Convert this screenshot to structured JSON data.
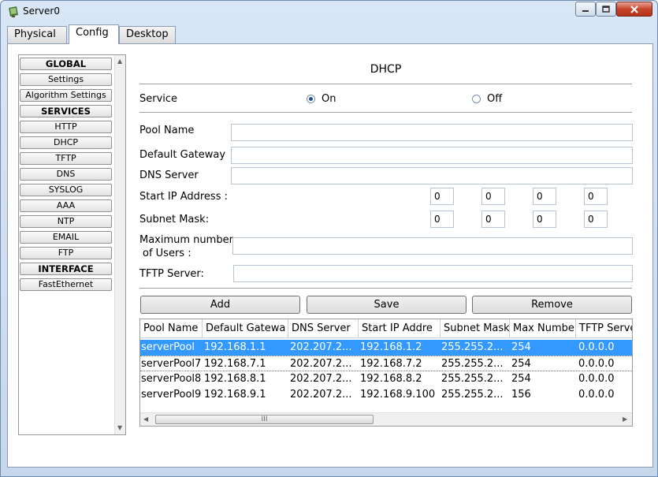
{
  "window": {
    "title": "Server0",
    "tabs": [
      "Physical",
      "Config",
      "Desktop"
    ],
    "active_tab": "Config"
  },
  "sidebar": {
    "items": [
      {
        "label": "GLOBAL",
        "header": true
      },
      {
        "label": "Settings"
      },
      {
        "label": "Algorithm Settings"
      },
      {
        "label": "SERVICES",
        "header": true
      },
      {
        "label": "HTTP"
      },
      {
        "label": "DHCP"
      },
      {
        "label": "TFTP"
      },
      {
        "label": "DNS"
      },
      {
        "label": "SYSLOG"
      },
      {
        "label": "AAA"
      },
      {
        "label": "NTP"
      },
      {
        "label": "EMAIL"
      },
      {
        "label": "FTP"
      },
      {
        "label": "INTERFACE",
        "header": true
      },
      {
        "label": "FastEthernet"
      }
    ]
  },
  "dhcp": {
    "heading": "DHCP",
    "service_label": "Service",
    "on_label": "On",
    "off_label": "Off",
    "service_state": "On",
    "pool_name_label": "Pool Name",
    "pool_name_value": "",
    "default_gateway_label": "Default Gateway",
    "default_gateway_value": "",
    "dns_server_label": "DNS Server",
    "dns_server_value": "",
    "start_ip_label": "Start IP Address :",
    "start_ip": [
      "0",
      "0",
      "0",
      "0"
    ],
    "subnet_mask_label": "Subnet Mask:",
    "subnet_mask": [
      "0",
      "0",
      "0",
      "0"
    ],
    "max_users_label_1": "Maximum number",
    "max_users_label_2": "of Users :",
    "max_users_value": "",
    "tftp_server_label": "TFTP Server:",
    "tftp_server_value": "",
    "add_label": "Add",
    "save_label": "Save",
    "remove_label": "Remove"
  },
  "table": {
    "columns": [
      "Pool Name",
      "Default Gatewa",
      "DNS Server",
      "Start IP Addre",
      "Subnet Mask",
      "Max Numbe",
      "TFTP Serve"
    ],
    "rows": [
      [
        "serverPool",
        "192.168.1.1",
        "202.207.2...",
        "192.168.1.2",
        "255.255.2...",
        "254",
        "0.0.0.0"
      ],
      [
        "serverPool7",
        "192.168.7.1",
        "202.207.2...",
        "192.168.7.2",
        "255.255.2...",
        "254",
        "0.0.0.0"
      ],
      [
        "serverPool8",
        "192.168.8.1",
        "202.207.2...",
        "192.168.8.2",
        "255.255.2...",
        "254",
        "0.0.0.0"
      ],
      [
        "serverPool9",
        "192.168.9.1",
        "202.207.2...",
        "192.168.9.100",
        "255.255.2...",
        "156",
        "0.0.0.0"
      ]
    ],
    "selected_row": 0,
    "scroll_thumb_glyph": "III"
  },
  "colors": {
    "selection": "#3399ff",
    "close_button": "#c6452c"
  }
}
